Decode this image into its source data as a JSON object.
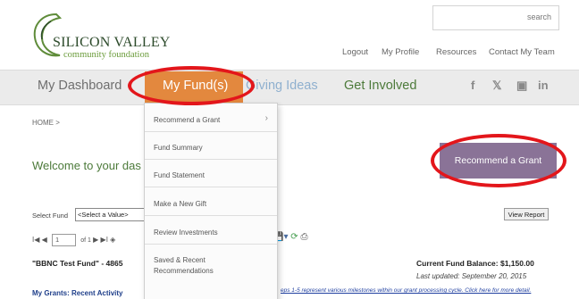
{
  "header": {
    "logo_line1": "SILICON VALLEY",
    "logo_line2": "community foundation",
    "search_label": "search",
    "links": [
      "Logout",
      "My Profile",
      "Resources",
      "Contact My Team"
    ]
  },
  "nav": {
    "items": [
      "My Dashboard",
      "My Fund(s)",
      "Giving Ideas",
      "Get Involved"
    ],
    "active_index": 1,
    "social": [
      "facebook",
      "twitter",
      "youtube",
      "linkedin"
    ],
    "social_glyphs": [
      "f",
      "𝕏",
      "▣",
      "in"
    ]
  },
  "dropdown": {
    "items": [
      {
        "label": "Recommend a Grant",
        "has_submenu": true
      },
      {
        "label": "Fund Summary"
      },
      {
        "label": "Fund Statement"
      },
      {
        "label": "Make a New Gift"
      },
      {
        "label": "Review Investments"
      },
      {
        "label": "Saved & Recent Recommendations"
      }
    ],
    "chevron": "›"
  },
  "main": {
    "breadcrumb": "HOME >",
    "welcome": "Welcome to your das",
    "recommend_button": "Recommend a Grant",
    "select_label": "Select Fund",
    "select_value": "<Select a Value>",
    "view_report": "View Report",
    "pager": {
      "first": "I◀",
      "prev": "◀",
      "page": "1",
      "of": "of 1",
      "next": "▶",
      "last": "▶I",
      "back": "◈"
    },
    "fund_name": "\"BBNC Test Fund\" - 4865",
    "balance": "Current Fund Balance:  $1,150.00",
    "updated": "Last updated: September 20,  2015",
    "grants_heading": "My Grants: Recent Activity",
    "grants_note": "eps 1-5 represent various milestones within our grant processing cycle.  Click here for more detail."
  },
  "colors": {
    "active_tab": "#e3883e",
    "recommend_button": "#8a7397",
    "annotation_ring": "#e3161b",
    "brand_green": "#4c7a3a"
  }
}
